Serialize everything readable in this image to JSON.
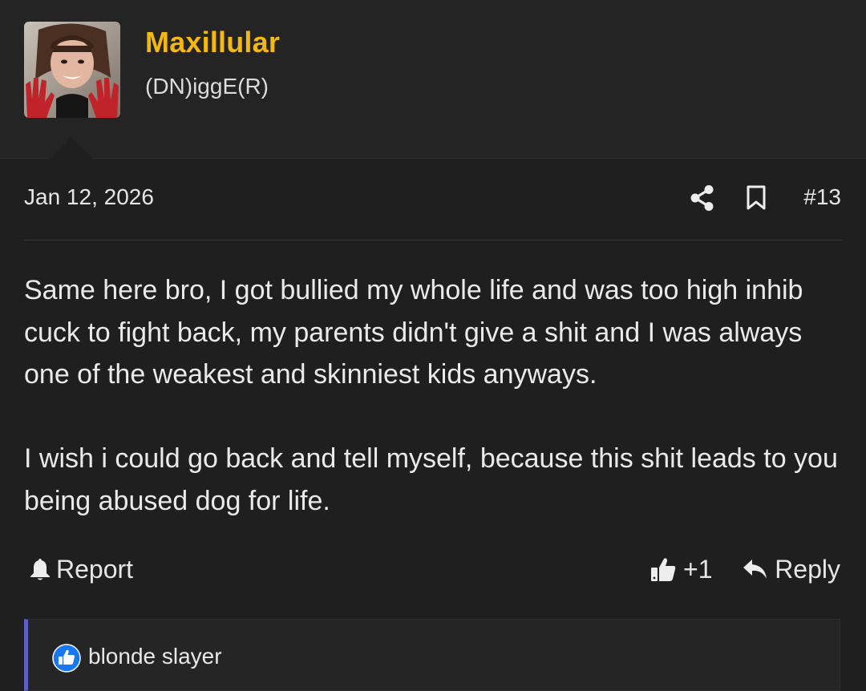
{
  "user": {
    "name": "Maxillular",
    "title": "(DN)iggE(R)",
    "avatar_icon": "avatar-photo",
    "name_color": "#f5b80c"
  },
  "post": {
    "date": "Jan 12, 2026",
    "number": "#13",
    "paragraphs": [
      "Same here bro, I got bullied my whole life and was too high inhib cuck to fight back, my parents didn't give a shit and I was always one of the weakest and skinniest kids anyways.",
      "I wish i could go back and tell myself, because this shit leads to you being abused dog for life."
    ],
    "header_icons": [
      "share-icon",
      "bookmark-icon"
    ]
  },
  "actions": {
    "report_label": "Report",
    "like_label": "+1",
    "reply_label": "Reply"
  },
  "reactions": {
    "reactor": "blonde slayer",
    "icon": "like-reaction-icon",
    "accent": "#5b5fc7"
  }
}
